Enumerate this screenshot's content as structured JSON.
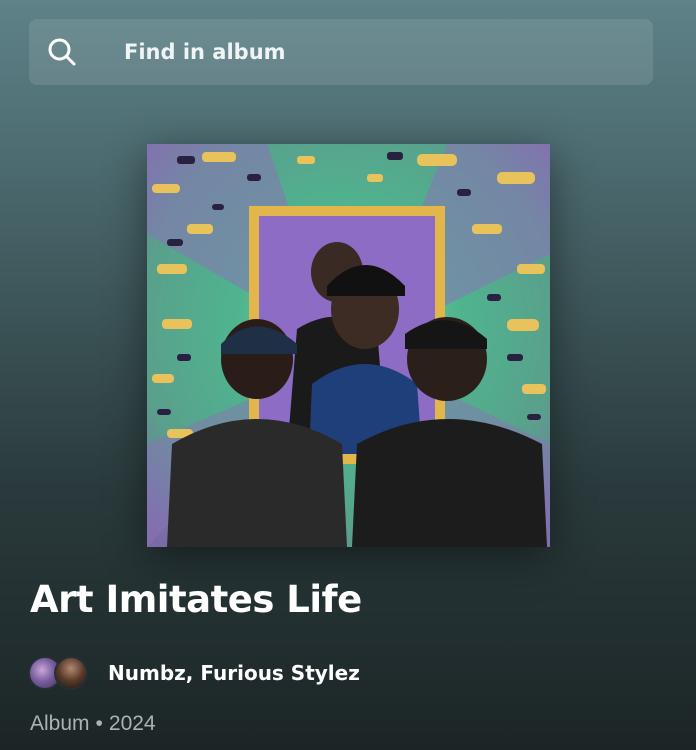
{
  "search": {
    "placeholder": "Find in album",
    "icon": "search-icon"
  },
  "album": {
    "title": "Art Imitates Life",
    "artists": "Numbz, Furious Stylez",
    "type": "Album",
    "separator": "•",
    "year": "2024"
  },
  "colors": {
    "background_top": "#5e8288",
    "background_bottom": "#1c2526",
    "meta_text": "#a9b3b4"
  }
}
